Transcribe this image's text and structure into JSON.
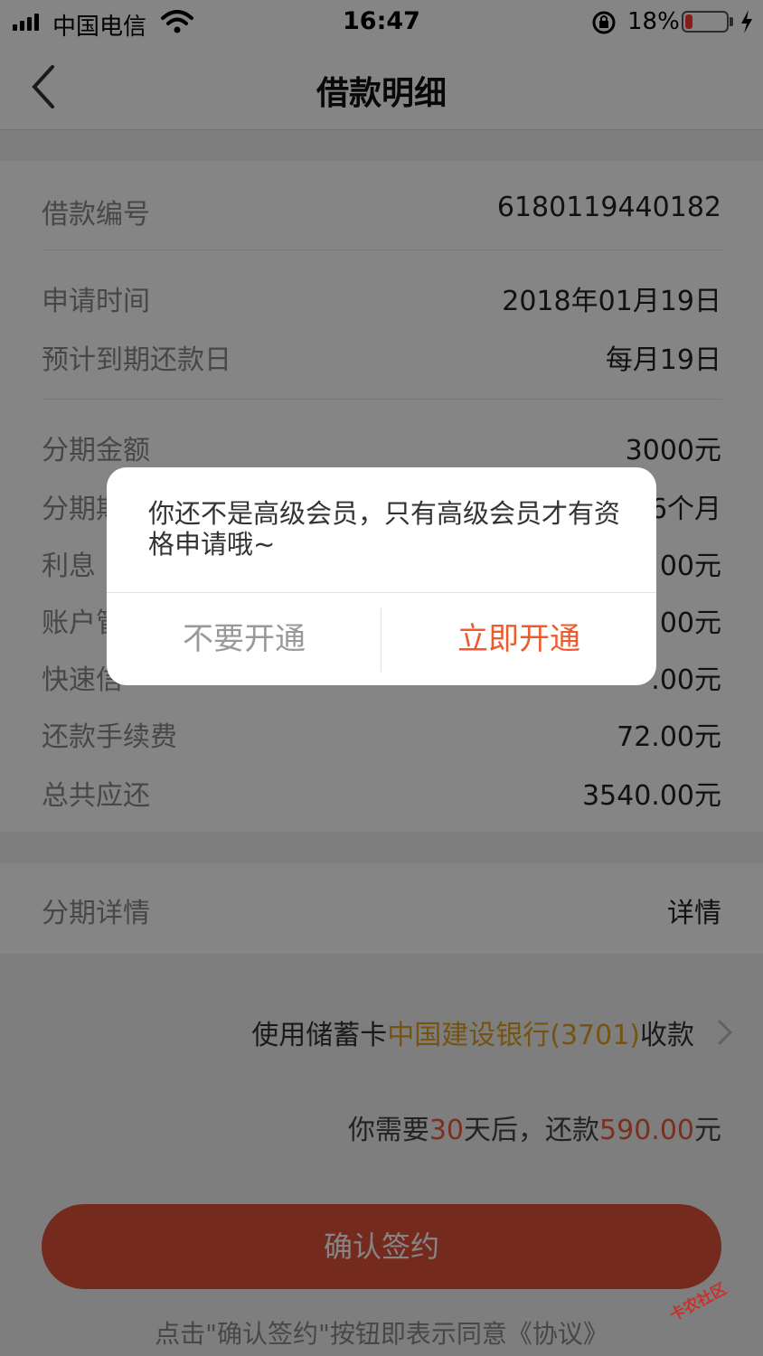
{
  "status_bar": {
    "carrier": "中国电信",
    "time": "16:47",
    "battery_percent": "18%",
    "battery_level": 0.18
  },
  "nav": {
    "title": "借款明细"
  },
  "loan_info": {
    "rows": [
      {
        "label": "借款编号",
        "value": "6180119440182"
      },
      {
        "label": "申请时间",
        "value": "2018年01月19日"
      },
      {
        "label": "预计到期还款日",
        "value": "每月19日"
      },
      {
        "label": "分期金额",
        "value": "3000元"
      },
      {
        "label": "分期期",
        "value": "6个月"
      },
      {
        "label": "利息",
        "value": "00元"
      },
      {
        "label": "账户管",
        "value": "00元"
      },
      {
        "label": "快速信",
        "value": ".00元"
      },
      {
        "label": "还款手续费",
        "value": "72.00元"
      },
      {
        "label": "总共应还",
        "value": "3540.00元"
      }
    ]
  },
  "installment": {
    "label": "分期详情",
    "link": "详情"
  },
  "collect": {
    "prefix": "使用储蓄卡",
    "bank": "中国建设银行(3701)",
    "suffix": "收款"
  },
  "repay": {
    "prefix": "你需要",
    "days": "30",
    "middle": "天后，还款",
    "amount": "590.00",
    "unit": "元"
  },
  "sign_button": "确认签约",
  "agreement_text": "点击\"确认签约\"按钮即表示同意《协议》",
  "dialog": {
    "message": "你还不是高级会员，只有高级会员才有资格申请哦~",
    "cancel": "不要开通",
    "confirm": "立即开通"
  },
  "watermark": "卡农社区",
  "colors": {
    "accent": "#ef5b2d",
    "link": "#1e88c9",
    "bank": "#e0a020"
  }
}
